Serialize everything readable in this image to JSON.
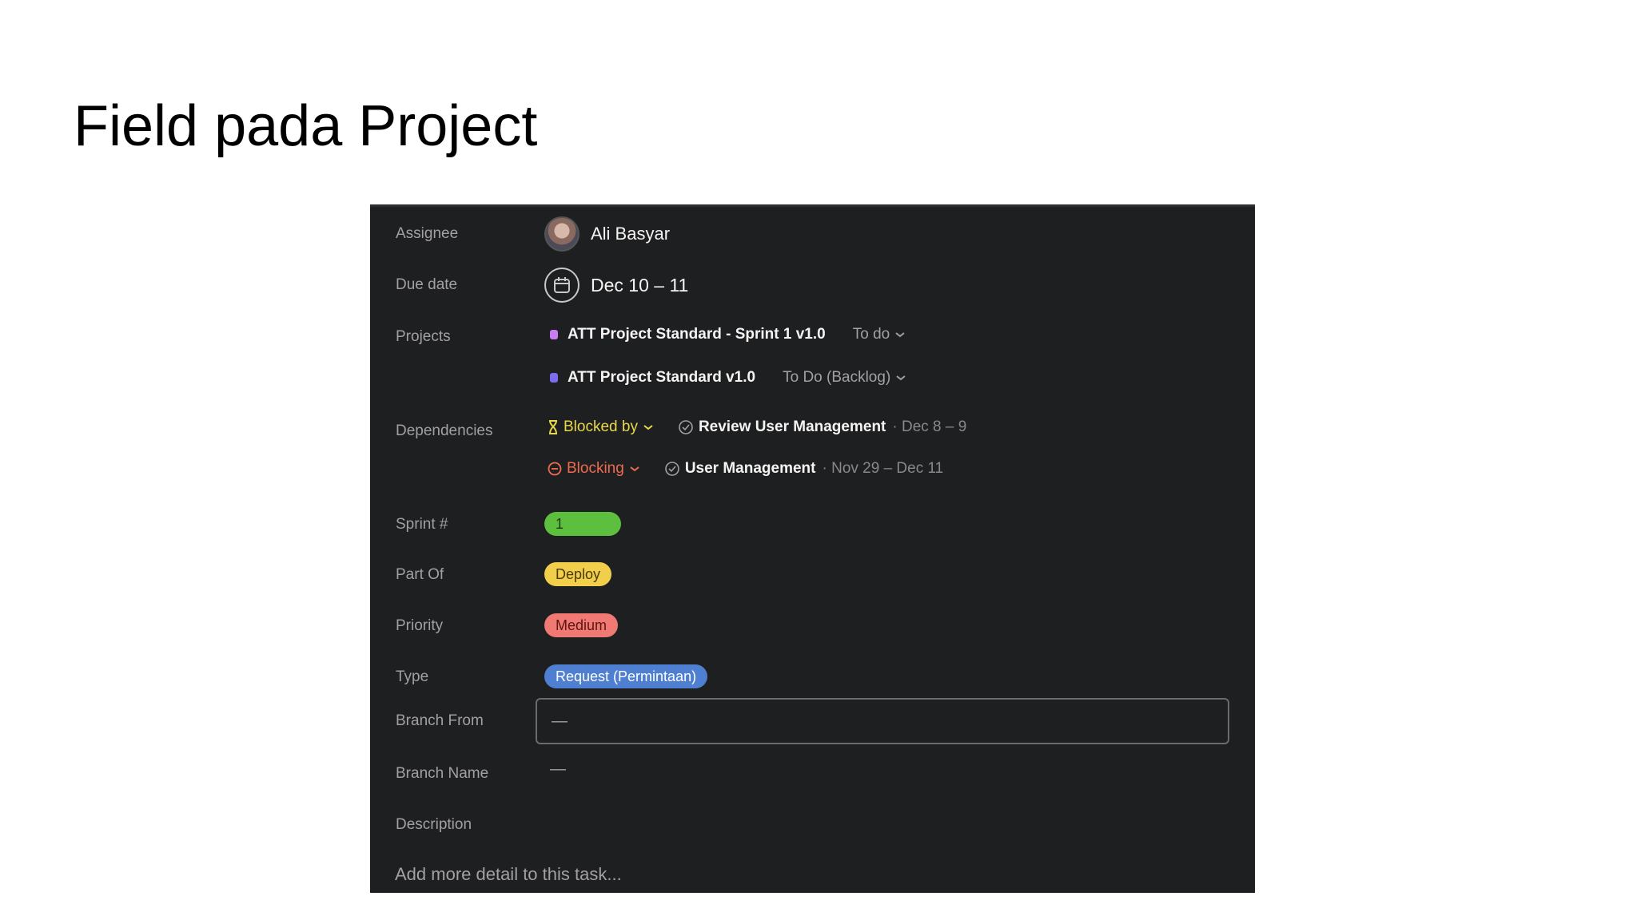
{
  "slide": {
    "title": "Field pada Project"
  },
  "task": {
    "assignee": {
      "label": "Assignee",
      "name": "Ali Basyar"
    },
    "due_date": {
      "label": "Due date",
      "value": "Dec 10 – 11"
    },
    "projects": {
      "label": "Projects",
      "items": [
        {
          "name": "ATT Project Standard - Sprint 1 v1.0",
          "status": "To do",
          "color": "#c77cf2"
        },
        {
          "name": "ATT Project Standard v1.0",
          "status": "To Do (Backlog)",
          "color": "#7b6cf0"
        }
      ]
    },
    "dependencies": {
      "label": "Dependencies",
      "items": [
        {
          "type": "Blocked by",
          "type_color": "#e8d84a",
          "task": "Review User Management",
          "date": "· Dec 8 – 9"
        },
        {
          "type": "Blocking",
          "type_color": "#f06a50",
          "task": "User Management",
          "date": "· Nov 29 – Dec 11"
        }
      ]
    },
    "sprint": {
      "label": "Sprint #",
      "value": "1",
      "color": "#5dbf3e"
    },
    "part_of": {
      "label": "Part Of",
      "value": "Deploy",
      "color": "#f1cf4a"
    },
    "priority": {
      "label": "Priority",
      "value": "Medium",
      "color": "#f07a73"
    },
    "type": {
      "label": "Type",
      "value": "Request (Permintaan)",
      "color": "#4f7fd1"
    },
    "branch_from": {
      "label": "Branch From",
      "value": "—"
    },
    "branch_name": {
      "label": "Branch Name",
      "value": "—"
    },
    "description": {
      "label": "Description",
      "placeholder": "Add more detail to this task..."
    }
  }
}
